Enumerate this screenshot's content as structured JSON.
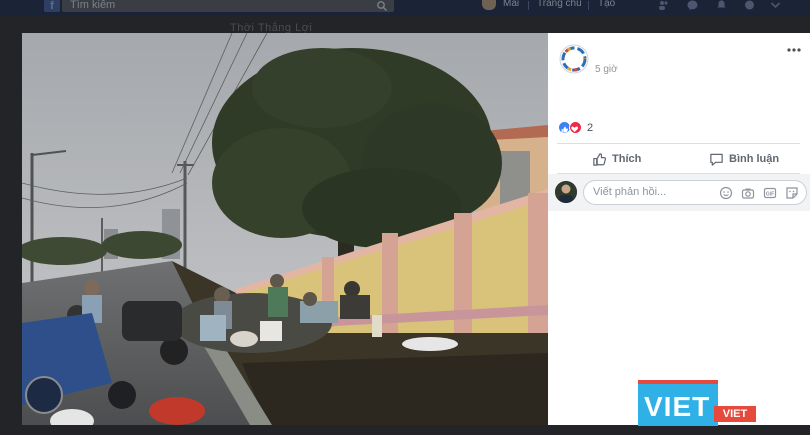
{
  "topbar": {
    "search_placeholder": "Tìm kiếm",
    "profile_name": "Mai",
    "home_label": "Trang chủ",
    "create_label": "Tạo"
  },
  "background_title": "Thời Thắng Lợi",
  "post": {
    "time": "5 giờ",
    "reaction_count": "2",
    "like_label": "Thích",
    "comment_label": "Bình luận"
  },
  "comment": {
    "placeholder": "Viết phản hồi..."
  },
  "watermark": {
    "main": "VIET",
    "sub": "VIET"
  },
  "colors": {
    "like_blue": "#3b82f6",
    "love_red": "#f0284a",
    "watermark_blue": "#2fb1e8",
    "watermark_red": "#e64a3c"
  }
}
